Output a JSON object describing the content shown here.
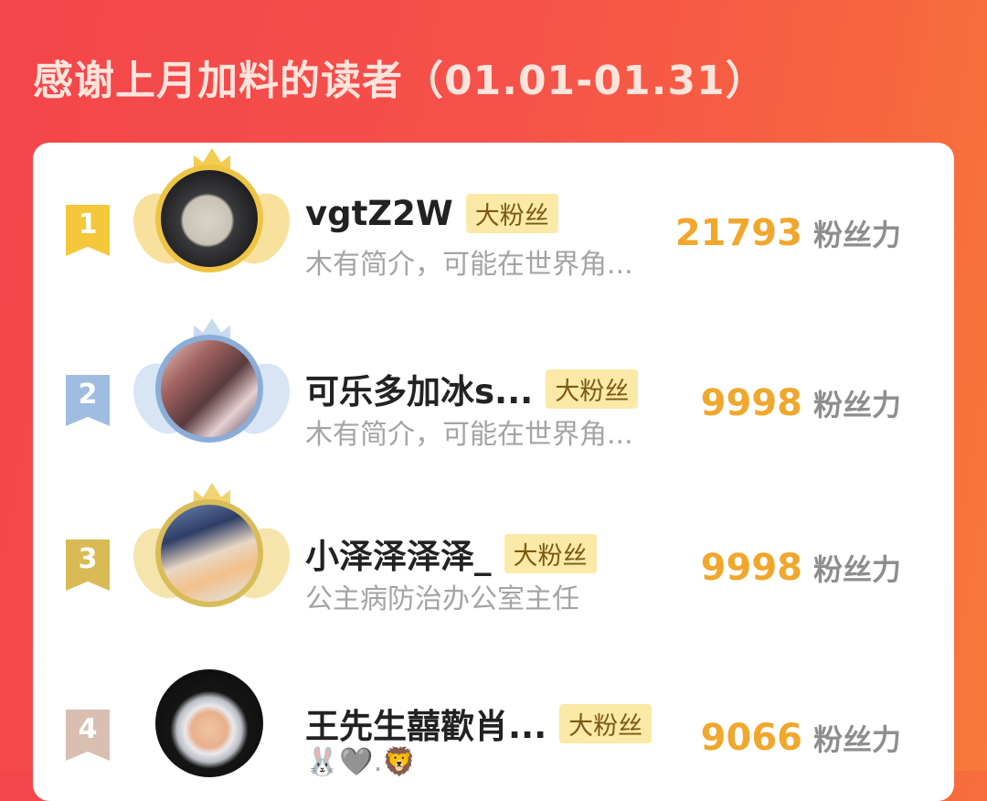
{
  "header": {
    "title": "感谢上月加料的读者（01.01-01.31）"
  },
  "readers": [
    {
      "rank": "1",
      "name": "vgtZ2W",
      "tag": "大粉丝",
      "bio": "木有简介，可能在世界角...",
      "score": "21793",
      "unit": "粉丝力",
      "avatar_icon": "moon-avatar"
    },
    {
      "rank": "2",
      "name": "可乐多加冰s...",
      "tag": "大粉丝",
      "bio": "木有简介，可能在世界角...",
      "score": "9998",
      "unit": "粉丝力",
      "avatar_icon": "anime-couple-avatar"
    },
    {
      "rank": "3",
      "name": "小泽泽泽泽_",
      "tag": "大粉丝",
      "bio": "公主病防治办公室主任",
      "score": "9998",
      "unit": "粉丝力",
      "avatar_icon": "anime-boy-avatar"
    },
    {
      "rank": "4",
      "name": "王先生囍歡肖...",
      "tag": "大粉丝",
      "bio": "🐰🩶.🦁",
      "score": "9066",
      "unit": "粉丝力",
      "avatar_icon": "astronaut-baby-avatar"
    }
  ],
  "colors": {
    "accent": "#f0a72c",
    "background_start": "#f4454a",
    "background_end": "#f8793a"
  }
}
